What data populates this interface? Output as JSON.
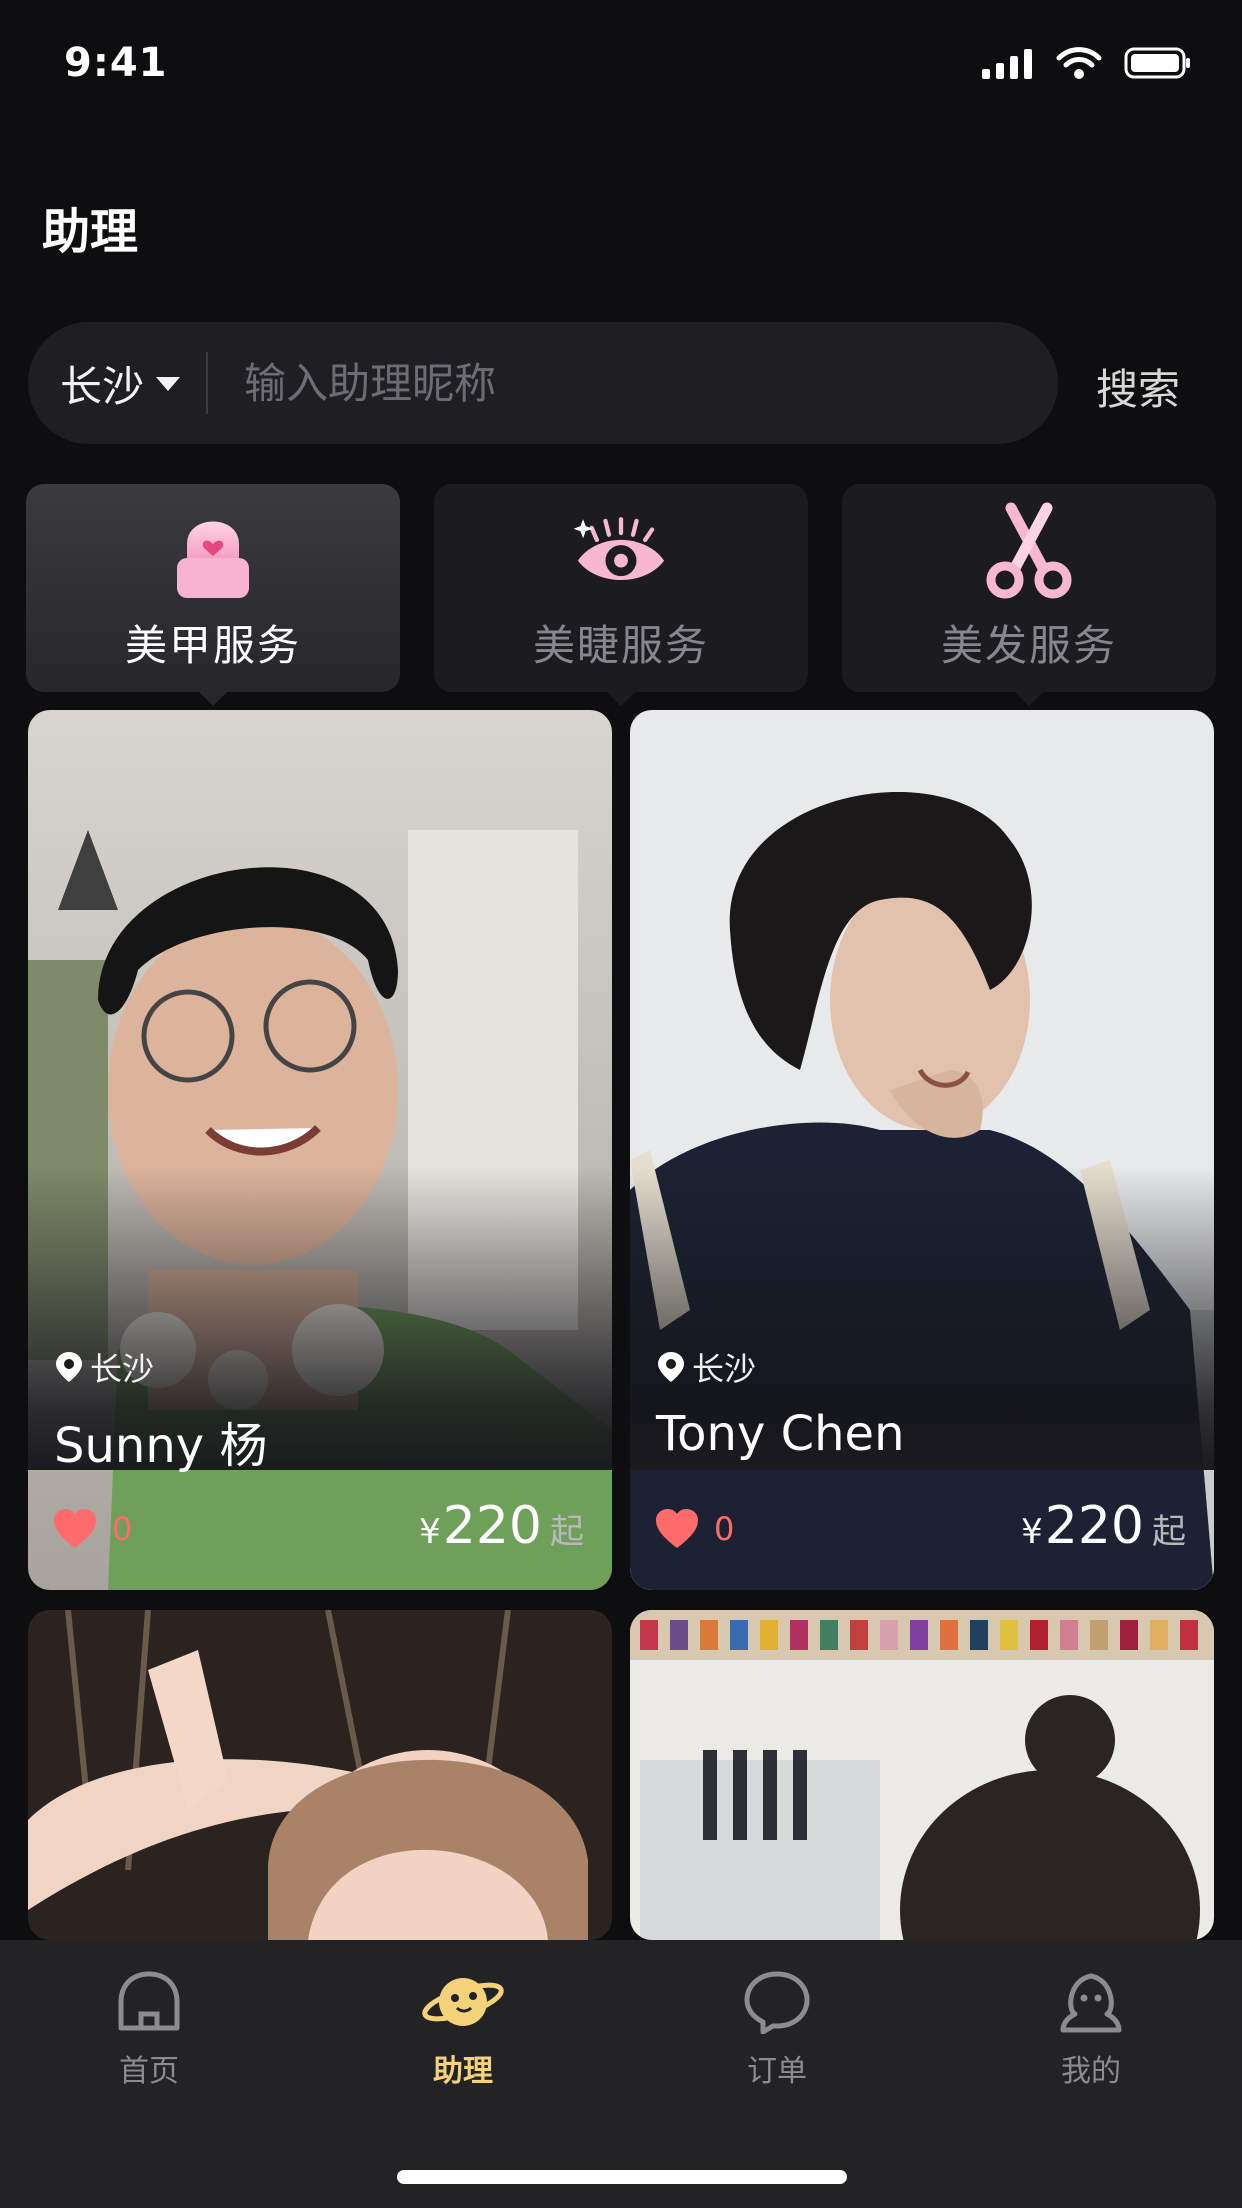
{
  "status_bar": {
    "time": "9:41"
  },
  "header": {
    "title": "助理"
  },
  "search": {
    "city": "长沙",
    "placeholder": "输入助理昵称",
    "button_label": "搜索"
  },
  "categories": [
    {
      "label": "美甲服务",
      "icon": "nail-icon",
      "active": true
    },
    {
      "label": "美睫服务",
      "icon": "eyelash-icon",
      "active": false
    },
    {
      "label": "美发服务",
      "icon": "scissors-icon",
      "active": false
    }
  ],
  "cards": [
    {
      "location": "长沙",
      "name": "Sunny 杨",
      "likes": "0",
      "price_symbol": "¥",
      "price": "220",
      "price_suffix": "起"
    },
    {
      "location": "长沙",
      "name": "Tony Chen",
      "likes": "0",
      "price_symbol": "¥",
      "price": "220",
      "price_suffix": "起"
    }
  ],
  "tabs": [
    {
      "label": "首页",
      "icon": "home-icon",
      "active": false
    },
    {
      "label": "助理",
      "icon": "planet-icon",
      "active": true
    },
    {
      "label": "订单",
      "icon": "chat-bubble-icon",
      "active": false
    },
    {
      "label": "我的",
      "icon": "person-icon",
      "active": false
    }
  ],
  "colors": {
    "background": "#0e0e11",
    "accent": "#f3d27a",
    "pink": "#f6a8c6",
    "like": "#ff6b6b"
  }
}
